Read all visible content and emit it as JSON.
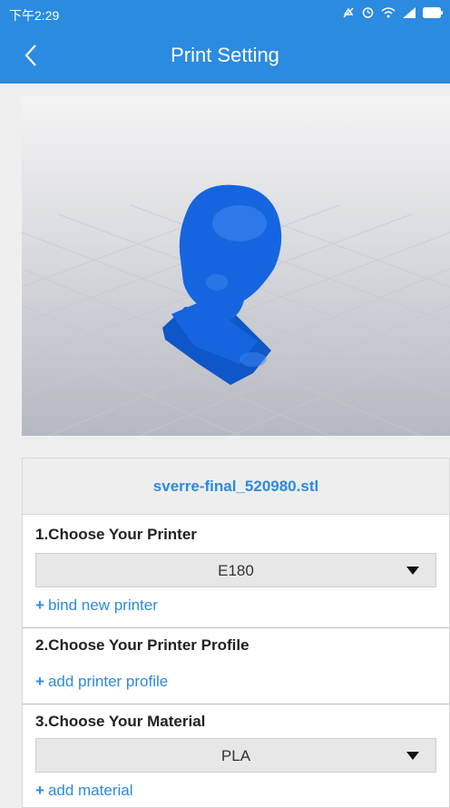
{
  "status_bar": {
    "time": "下午2:29",
    "icons": [
      "mute-icon",
      "alarm-icon",
      "wifi-icon",
      "signal-icon",
      "battery-icon"
    ]
  },
  "app_bar": {
    "title": "Print Setting",
    "back_icon": "chevron-left-icon"
  },
  "colors": {
    "primary": "#2b8be0",
    "model": "#1565e0"
  },
  "model_viewer": {
    "file_name": "sverre-final_520980.stl"
  },
  "sections": {
    "printer": {
      "title": "1.Choose Your Printer",
      "selected": "E180",
      "link_plus": "+",
      "link_label": "bind new printer"
    },
    "profile": {
      "title": "2.Choose Your Printer Profile",
      "link_plus": "+",
      "link_label": "add printer profile"
    },
    "material": {
      "title": "3.Choose Your Material",
      "selected": "PLA",
      "link_plus": "+",
      "link_label": "add material"
    }
  }
}
